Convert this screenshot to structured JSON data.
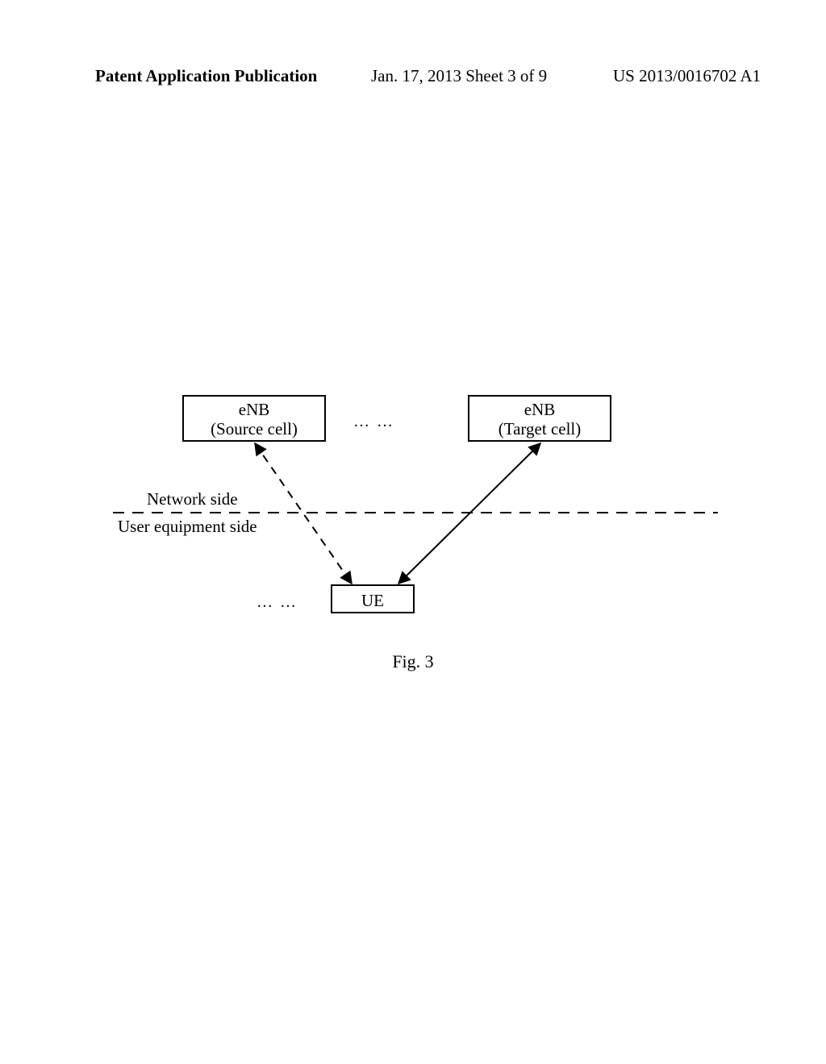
{
  "header": {
    "left": "Patent Application Publication",
    "center": "Jan. 17, 2013  Sheet 3 of 9",
    "right": "US 2013/0016702 A1"
  },
  "diagram": {
    "source": {
      "line1": "eNB",
      "line2": "(Source cell)"
    },
    "target": {
      "line1": "eNB",
      "line2": "(Target cell)"
    },
    "ue": "UE",
    "dots_top": "… …",
    "dots_bottom": "… …",
    "label_network": "Network side",
    "label_user": "User equipment side",
    "caption": "Fig. 3"
  }
}
